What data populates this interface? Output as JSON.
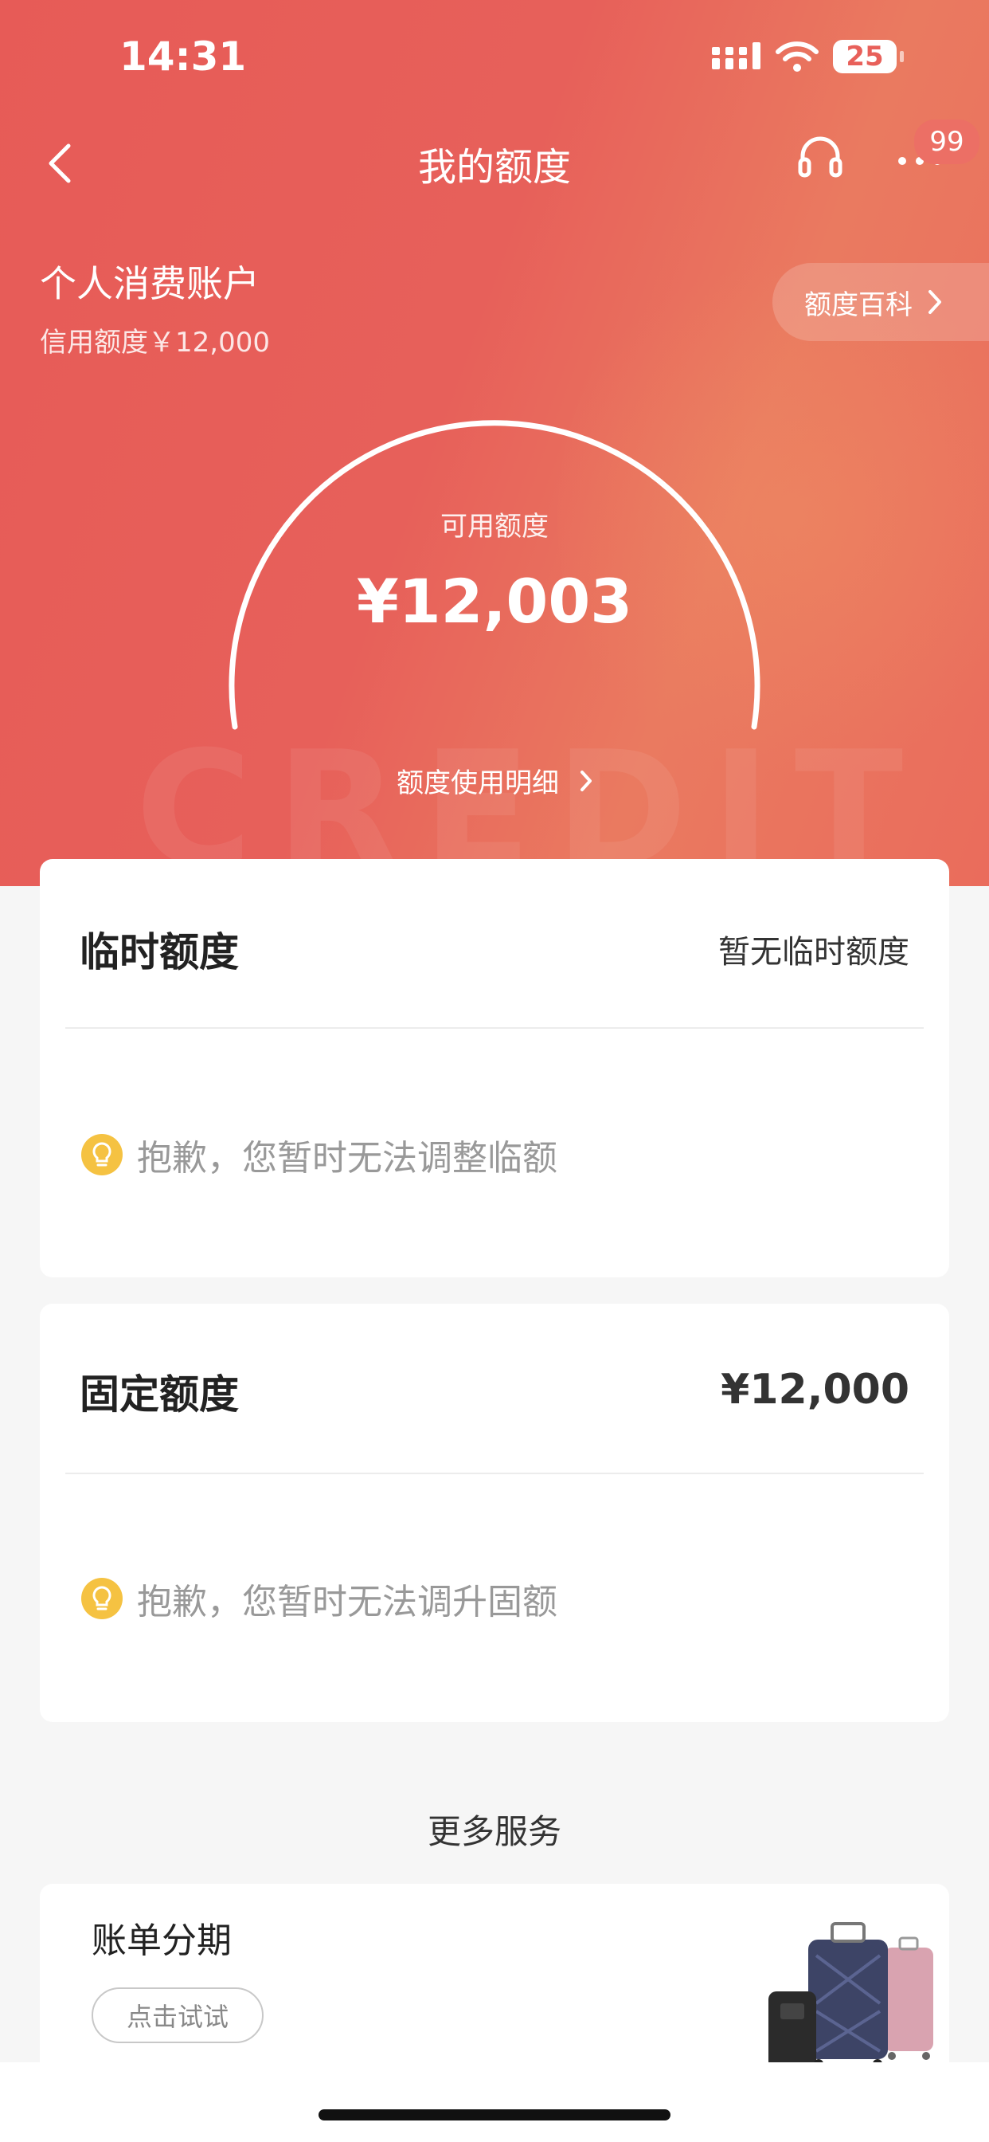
{
  "status": {
    "time": "14:31",
    "battery": "25"
  },
  "nav": {
    "title": "我的额度",
    "badge": "99",
    "back_icon": "chevron-left-icon",
    "support_icon": "headset-icon",
    "more_icon": "more-dots-icon"
  },
  "account": {
    "name": "个人消费账户",
    "credit_limit": "信用额度￥12,000",
    "encyclopedia_label": "额度百科"
  },
  "gauge": {
    "available_label": "可用额度",
    "available_amount": "¥12,003",
    "detail_link": "额度使用明细"
  },
  "temporary": {
    "title": "临时额度",
    "status": "暂无临时额度",
    "tip": "抱歉，您暂时无法调整临额"
  },
  "fixed": {
    "title": "固定额度",
    "amount": "¥12,000",
    "tip": "抱歉，您暂时无法调升固额"
  },
  "services": {
    "section_title": "更多服务",
    "items": [
      {
        "title": "账单分期",
        "button": "点击试试"
      }
    ]
  },
  "colors": {
    "brand": "#e75b57",
    "bulb": "#f5c242"
  }
}
